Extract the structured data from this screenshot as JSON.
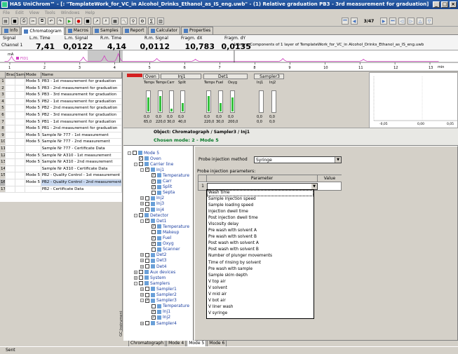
{
  "window": {
    "title": "HAS UniChrom™ - [: \"TemplateWork_for_VC_in Alcohol_Drinks_Ethanol_as_IS_eng.uwb\" - (1) Relative graduation PB3 - 3rd measurement for graduation]"
  },
  "menu": [
    "File",
    "Edit",
    "View",
    "Tools",
    "Windows",
    "Help"
  ],
  "toolbar": {
    "counter": "3/47"
  },
  "tabs": [
    {
      "label": "Info"
    },
    {
      "label": "Chromatogram"
    },
    {
      "label": "Macros"
    },
    {
      "label": "Samples"
    },
    {
      "label": "Report"
    },
    {
      "label": "Calculator"
    },
    {
      "label": "Properties"
    }
  ],
  "readouts": {
    "signal_label": "Signal",
    "channel": "Channel 1",
    "lm_time_label": "L.m. Time",
    "lm_time": "7,41",
    "lm_signal_label": "L.m. Signal",
    "lm_signal": "0,0122",
    "rm_time_label": "R.m. Time",
    "rm_time": "4,14",
    "rm_signal_label": "R.m. Signal",
    "rm_signal": "0,0112",
    "fragm_dx_label": "Fragm. dX",
    "fragm_dx": "10,783",
    "fragm_dy_label": "Fragm. dY",
    "fragm_dy": "0,0135",
    "library": "Library: Components of 1 layer of TemplateWork_for_VC_in Alcohol_Drinks_Ethanol_as_IS_eng.uwb",
    "unit": "mA",
    "series": "FID1",
    "axis_unit": "min"
  },
  "chart_data": {
    "type": "line",
    "x_ticks": [
      1,
      2,
      3,
      4,
      5,
      6,
      7,
      8,
      9,
      10,
      11,
      12,
      13
    ],
    "xlabel": "min",
    "series": [
      {
        "name": "FID1",
        "color": "#d040c0"
      }
    ],
    "markers": [
      4.14,
      7.41
    ]
  },
  "grid": {
    "headers": [
      "",
      "Bracket",
      "Sample",
      "Mode",
      "Name"
    ],
    "rows": [
      {
        "n": "1",
        "mode": "Mode 5",
        "name": "PB3 - 1st measurement for graduation"
      },
      {
        "n": "2",
        "mode": "Mode 5",
        "name": "PB3 - 2nd measurement for graduation"
      },
      {
        "n": "3",
        "mode": "Mode 5",
        "name": "PB3 - 3rd measurement for graduation"
      },
      {
        "n": "4",
        "mode": "Mode 5",
        "name": "PB2 - 1st measurement for graduation"
      },
      {
        "n": "5",
        "mode": "Mode 5",
        "name": "PB2 - 2nd measurement for graduation"
      },
      {
        "n": "6",
        "mode": "Mode 5",
        "name": "PB2 - 3rd measurement for graduation"
      },
      {
        "n": "7",
        "mode": "Mode 5",
        "name": "PB1 - 1st measurement for graduation"
      },
      {
        "n": "8",
        "mode": "Mode 5",
        "name": "PB1 - 2nd measurement for graduation"
      },
      {
        "n": "9",
        "mode": "Mode 5",
        "name": "Sample Nr 777 - 1st measurement"
      },
      {
        "n": "10",
        "mode": "Mode 5",
        "name": "Sample Nr 777 - 2nd measurement"
      },
      {
        "n": "11",
        "mode": "",
        "name": "Sample Nr 777 - Certificate Data"
      },
      {
        "n": "12",
        "mode": "Mode 5",
        "name": "Sample Nr A310 - 1st measurement"
      },
      {
        "n": "13",
        "mode": "Mode 5",
        "name": "Sample Nr A310 - 2nd measurement"
      },
      {
        "n": "14",
        "mode": "",
        "name": "Sample Nr A310 - Certificate Data"
      },
      {
        "n": "15",
        "mode": "Mode 5",
        "name": "PB2 - Quality Control - 1st measurement"
      },
      {
        "n": "16",
        "mode": "Mode 5",
        "name": "PB2 - Quality Control - 2nd measurement"
      },
      {
        "n": "17",
        "mode": "",
        "name": "PB2 - Certificate Data"
      }
    ]
  },
  "devices": {
    "oven": "Oven",
    "inj1": "Inj1",
    "det1": "Det1",
    "sampler3": "Sampler3",
    "gauges": [
      {
        "label": "Temper",
        "level": 0.7,
        "v1": "0,0",
        "v2": "65,0"
      },
      {
        "label": "Temper",
        "level": 0.75,
        "v1": "0,0",
        "v2": "220,0"
      },
      {
        "label": "Carr",
        "level": 0.15,
        "v1": "0,0",
        "v2": "30,0"
      },
      {
        "label": "Split",
        "level": 0.4,
        "v1": "0,0",
        "v2": "40,0"
      },
      {
        "label": "Temper",
        "level": 0.75,
        "v1": "0,0",
        "v2": "220,0"
      },
      {
        "label": "Fuel",
        "level": 0.4,
        "v1": "0,0",
        "v2": "30,0"
      },
      {
        "label": "Oxyg",
        "level": 0.7,
        "v1": "0,0",
        "v2": "200,0"
      },
      {
        "label": "Inj1",
        "level": 0.0,
        "v1": "0,0",
        "v2": "0,0"
      },
      {
        "label": "Inj2",
        "level": 0.0,
        "v1": "0,0",
        "v2": "0,0"
      }
    ],
    "miniplot_ticks": [
      "-0,05",
      "0,00",
      "0,05"
    ]
  },
  "object": {
    "title": "Object: Chromatograph / Sampler3 / Inj1",
    "chosen": "Chosen mode: 2 - Mode 5"
  },
  "tree": [
    {
      "label": "Mode 5",
      "d": 0,
      "cb": "",
      "ex": "-"
    },
    {
      "label": "Oven",
      "d": 1,
      "cb": "✓",
      "ex": ""
    },
    {
      "label": "Carrier line",
      "d": 1,
      "cb": "",
      "ex": "-"
    },
    {
      "label": "Inj1",
      "d": 2,
      "cb": "✓",
      "ex": "-"
    },
    {
      "label": "Temperature",
      "d": 3,
      "cb": "✓",
      "ex": ""
    },
    {
      "label": "Carr",
      "d": 3,
      "cb": "✓",
      "ex": ""
    },
    {
      "label": "Split",
      "d": 3,
      "cb": "✓",
      "ex": ""
    },
    {
      "label": "Septa",
      "d": 3,
      "cb": "",
      "ex": ""
    },
    {
      "label": "Inj2",
      "d": 2,
      "cb": "",
      "ex": "+"
    },
    {
      "label": "Inj3",
      "d": 2,
      "cb": "",
      "ex": "+"
    },
    {
      "label": "Inj4",
      "d": 2,
      "cb": "",
      "ex": "+"
    },
    {
      "label": "Detector",
      "d": 1,
      "cb": "",
      "ex": "-"
    },
    {
      "label": "Det1",
      "d": 2,
      "cb": "✓",
      "ex": "-"
    },
    {
      "label": "Temperature",
      "d": 3,
      "cb": "✓",
      "ex": ""
    },
    {
      "label": "Makeup",
      "d": 3,
      "cb": "",
      "ex": ""
    },
    {
      "label": "Fuel",
      "d": 3,
      "cb": "✓",
      "ex": ""
    },
    {
      "label": "Oxyg",
      "d": 3,
      "cb": "✓",
      "ex": ""
    },
    {
      "label": "Scanner",
      "d": 3,
      "cb": "",
      "ex": ""
    },
    {
      "label": "Det2",
      "d": 2,
      "cb": "",
      "ex": "+"
    },
    {
      "label": "Det3",
      "d": 2,
      "cb": "",
      "ex": "+"
    },
    {
      "label": "Det4",
      "d": 2,
      "cb": "",
      "ex": "+"
    },
    {
      "label": "Aux devices",
      "d": 1,
      "cb": "",
      "ex": "+"
    },
    {
      "label": "System",
      "d": 1,
      "cb": "",
      "ex": "+"
    },
    {
      "label": "Samplers",
      "d": 1,
      "cb": "",
      "ex": "-"
    },
    {
      "label": "Sampler1",
      "d": 2,
      "cb": "",
      "ex": "+"
    },
    {
      "label": "Sampler2",
      "d": 2,
      "cb": "",
      "ex": "+"
    },
    {
      "label": "Sampler3",
      "d": 2,
      "cb": "✓",
      "ex": "-"
    },
    {
      "label": "Temperature",
      "d": 3,
      "cb": "",
      "ex": ""
    },
    {
      "label": "Inj1",
      "d": 3,
      "cb": "✓",
      "ex": ""
    },
    {
      "label": "Inj2",
      "d": 3,
      "cb": "✓",
      "ex": ""
    },
    {
      "label": "Sampler4",
      "d": 2,
      "cb": "",
      "ex": "+"
    }
  ],
  "tree_side_label": "GC Instrument",
  "probe": {
    "method_label": "Probe injection method",
    "method_value": "Syringe",
    "params_label": "Probe injection parameters:",
    "col_param": "Parameter",
    "col_value": "Value",
    "row_num": "1",
    "options": [
      "Wash time",
      "Sample injection speed",
      "Sample loading speed",
      "Injection dwell time",
      "Post injection dwell time",
      "Viscosity delay",
      "Pre wash with solvent A",
      "Pre wash with solvent B",
      "Post wash with solvent A",
      "Post wash with solvent B",
      "Number of plunger movements",
      "Time of rinsing by solvent",
      "Pre wash with sample",
      "Sample skim depth",
      "V top air",
      "V solvent",
      "V mid air",
      "V bot air",
      "V liner wash",
      "V syringe"
    ]
  },
  "bottom_tabs": [
    "Chromatograph",
    "Mode 4",
    "Mode 5",
    "Mode 6"
  ],
  "status": "Sent"
}
